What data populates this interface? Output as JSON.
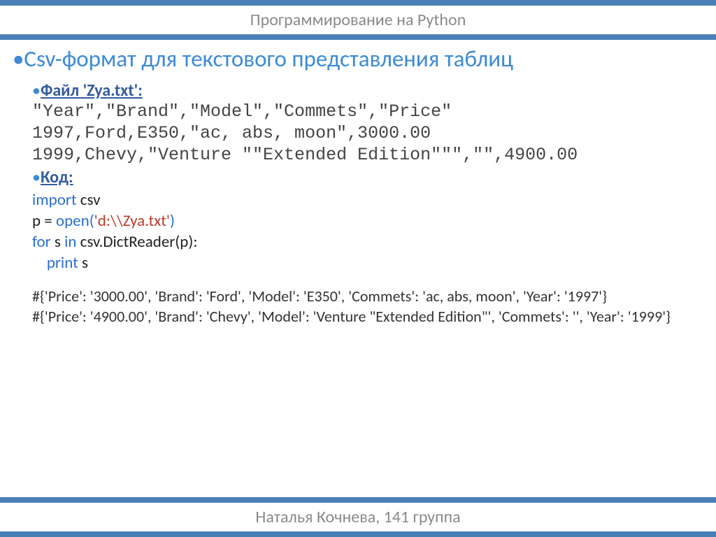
{
  "header": "Программирование на Python",
  "footer": "Наталья Кочнева, 141 группа",
  "heading": "•Csv-формат для текстового представления таблиц",
  "file_label_bullet": "•",
  "file_label": "Файл 'Zya.txt':",
  "file_content": "\"Year\",\"Brand\",\"Model\",\"Commets\",\"Price\"\n1997,Ford,E350,\"ac, abs, moon\",3000.00\n1999,Chevy,\"Venture \"\"Extended Edition\"\"\",\"\",4900.00",
  "code_label_bullet": "•",
  "code_label": "Код:",
  "code": {
    "l1_kw": "import",
    "l1_rest": " csv",
    "l2_a": "p = ",
    "l2_open": "open(",
    "l2_str": "'d:\\\\Zya.txt'",
    "l2_close": ")",
    "l3_for": "for",
    "l3_a": " s ",
    "l3_in": "in",
    "l3_b": " csv.DictReader(",
    "l3_p": "p",
    "l3_c": "):",
    "l4_indent": "    ",
    "l4_print": "print",
    "l4_s": " s"
  },
  "output1": "#{'Price': '3000.00', 'Brand': 'Ford', 'Model': 'E350', 'Commets': 'ac, abs, moon', 'Year': '1997'}",
  "output2": "#{'Price': '4900.00', 'Brand': 'Chevy', 'Model': 'Venture \"Extended Edition\"', 'Commets': '', 'Year': '1999'}"
}
